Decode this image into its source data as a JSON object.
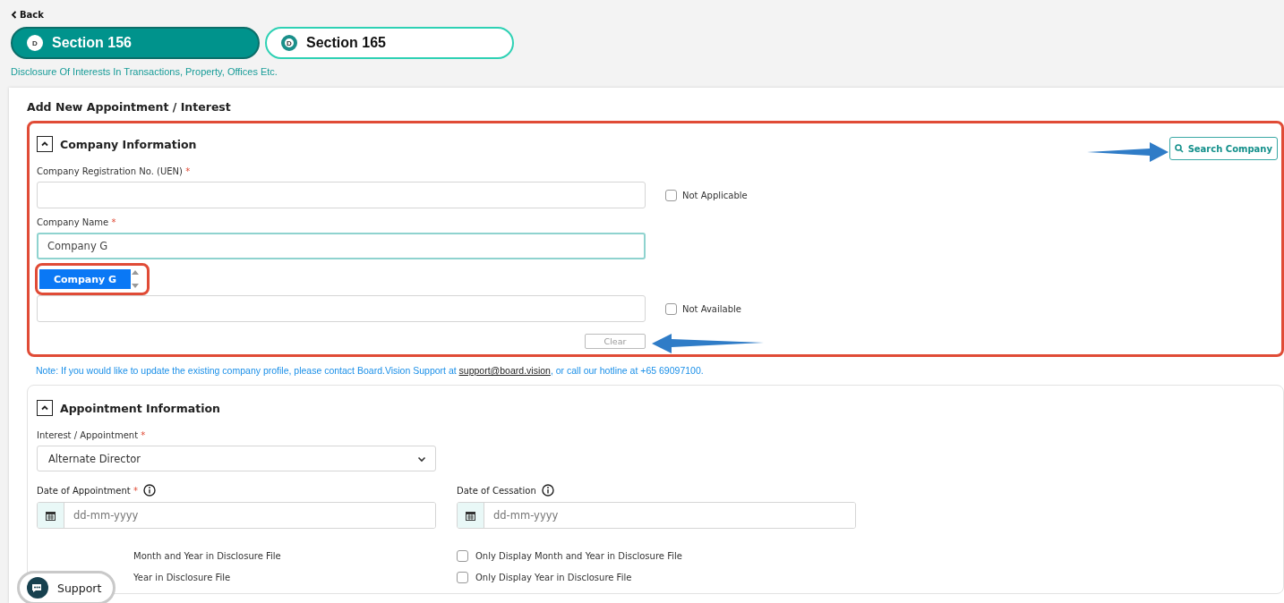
{
  "back": "Back",
  "tabs": [
    {
      "badge": "D",
      "label": "Section 156",
      "selected": true
    },
    {
      "badge": "D",
      "label": "Section 165",
      "selected": false
    }
  ],
  "subtitle": "Disclosure Of Interests In Transactions, Property, Offices Etc.",
  "form_title": "Add New Appointment / Interest",
  "company": {
    "title": "Company Information",
    "expanded": true,
    "search_button": "Search Company",
    "fields": [
      {
        "label": "Company Registration No. (UEN)",
        "required_mark": "*",
        "focused": false,
        "checkbox": {
          "label": "Not Applicable",
          "checked": false
        }
      },
      {
        "label": "Company Name",
        "required_mark": "*",
        "value": "Company G",
        "focused": true
      },
      {
        "focused": false,
        "checkbox": {
          "label": "Not Available",
          "checked": false
        }
      }
    ],
    "suggestion": {
      "label": "Company G",
      "selected": true
    },
    "clear_button": "Clear",
    "note": {
      "before": "Note: If you would like to update the existing company profile, please contact Board.Vision Support at ",
      "link": "support@board.vision",
      "after": ", or call our hotline at +65 69097100."
    }
  },
  "appointment": {
    "title": "Appointment Information",
    "expanded": true,
    "interest": {
      "label": "Interest / Appointment",
      "required_mark": "*",
      "value": "Alternate Director"
    },
    "dates": [
      {
        "label": "Date of Appointment",
        "required_mark": "*",
        "placeholder": "dd-mm-yyyy"
      },
      {
        "label": "Date of Cessation",
        "placeholder": "dd-mm-yyyy"
      }
    ],
    "options": [
      {
        "left": "Month and Year in Disclosure File",
        "right": "Only Display Month and Year in Disclosure File",
        "right_checked": false
      },
      {
        "left": "Year in Disclosure File",
        "right": "Only Display Year in Disclosure File",
        "right_checked": false
      }
    ]
  },
  "support": "Support"
}
